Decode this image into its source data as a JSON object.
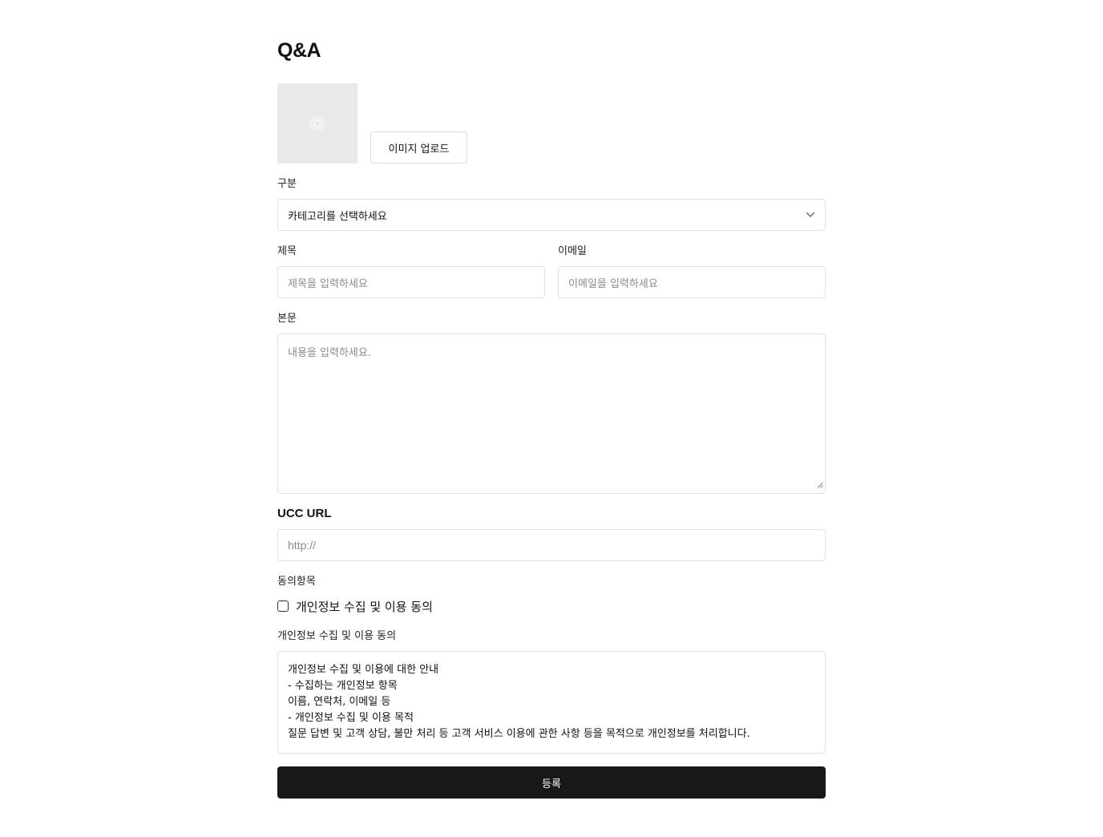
{
  "page": {
    "title": "Q&A"
  },
  "image_upload": {
    "preview_icon": "image-placeholder-icon",
    "button_label": "이미지 업로드"
  },
  "category": {
    "label": "구분",
    "selected_value": "카테고리를 선택하세요",
    "icon": "chevron-down-icon"
  },
  "title_field": {
    "label": "제목",
    "placeholder": "제목을 입력하세요"
  },
  "email_field": {
    "label": "이메일",
    "placeholder": "이메일을 입력하세요"
  },
  "body_field": {
    "label": "본문",
    "placeholder": "내용을 입력하세요."
  },
  "ucc_url": {
    "label": "UCC URL",
    "placeholder": "http://"
  },
  "consent": {
    "section_label": "동의항목",
    "checkbox_label": "개인정보 수집 및 이용 동의",
    "checked": false
  },
  "privacy_notice": {
    "label": "개인정보 수집 및 이용 동의",
    "lines": [
      "개인정보 수집 및 이용에 대한 안내",
      "- 수집하는 개인정보 항목",
      "이름, 연락처, 이메일 등",
      "- 개인정보 수집 및 이용 목적",
      "질문 답변 및 고객 상담, 불만 처리 등 고객 서비스 이용에 관한 사항 등을 목적으로 개인정보를 처리합니다."
    ]
  },
  "submit": {
    "label": "등록"
  },
  "colors": {
    "submit_background": "#18181b",
    "border": "#e1e1e1",
    "image_placeholder": "#e9e9e9"
  }
}
